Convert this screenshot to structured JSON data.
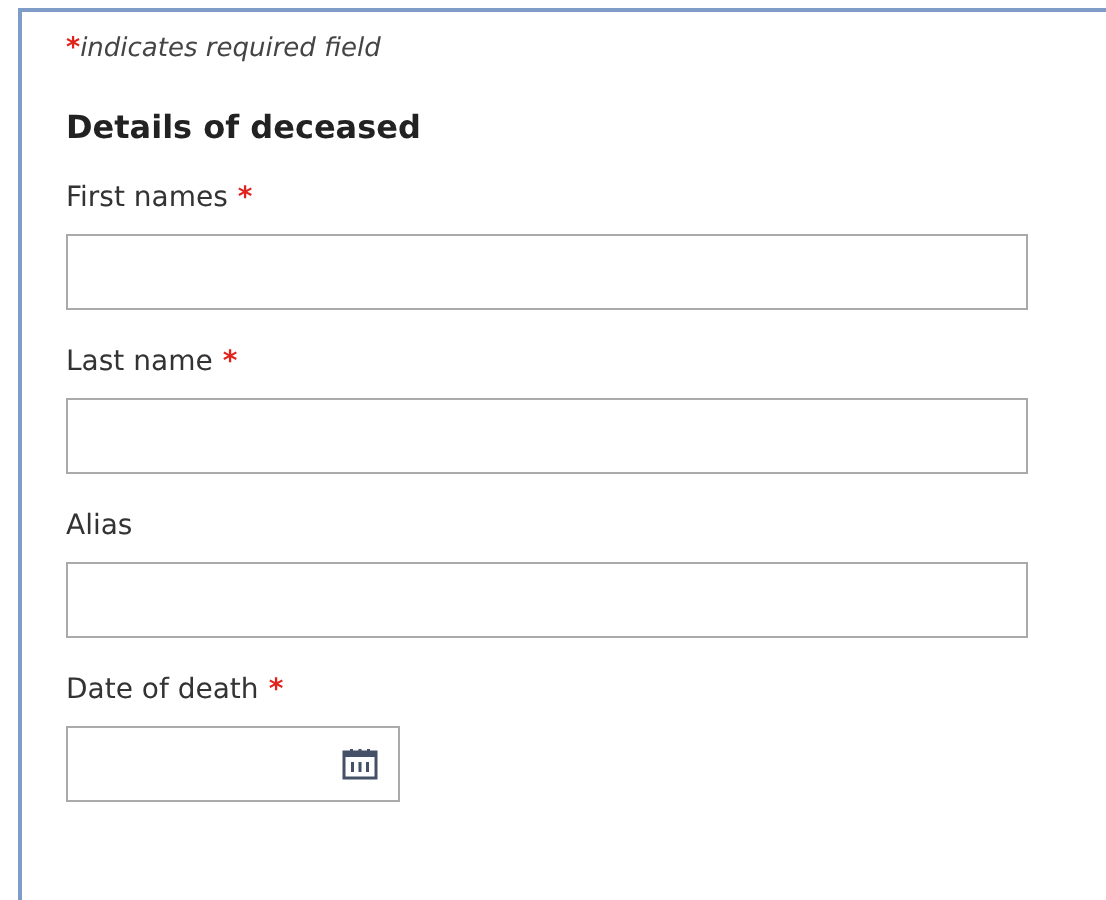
{
  "note": {
    "mark": "*",
    "text": "indicates required field"
  },
  "section": {
    "title": "Details of deceased"
  },
  "fields": [
    {
      "kind": "text",
      "label": "First names",
      "required_mark": "*"
    },
    {
      "kind": "text",
      "label": "Last name",
      "required_mark": "*"
    },
    {
      "kind": "text",
      "label": "Alias"
    },
    {
      "kind": "date",
      "label": "Date of death",
      "required_mark": "*"
    }
  ]
}
